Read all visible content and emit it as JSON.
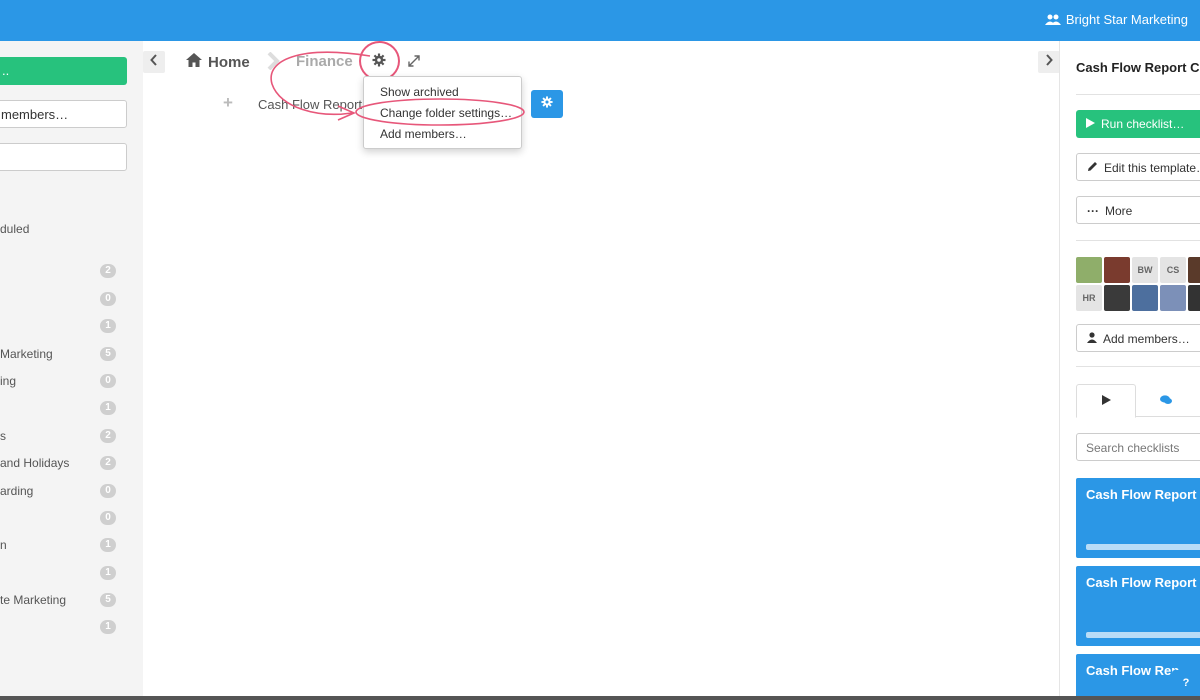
{
  "topbar": {
    "org_name": "Bright Star Marketing",
    "accent": "#2b97e6"
  },
  "left_sidebar": {
    "green_button_label": "..",
    "members_button_label": "members…",
    "items": [
      {
        "label": "duled"
      },
      {
        "label": "",
        "count": "2"
      },
      {
        "label": "",
        "count": "0"
      },
      {
        "label": "",
        "count": "1"
      },
      {
        "label": "Marketing",
        "count": "5"
      },
      {
        "label": "ing",
        "count": "0"
      },
      {
        "label": "",
        "count": "1"
      },
      {
        "label": "s",
        "count": "2"
      },
      {
        "label": "and Holidays",
        "count": "2"
      },
      {
        "label": "arding",
        "count": "0"
      },
      {
        "label": "",
        "count": "0"
      },
      {
        "label": "n",
        "count": "1"
      },
      {
        "label": "",
        "count": "1"
      },
      {
        "label": "te Marketing",
        "count": "5"
      },
      {
        "label": "",
        "count": "1"
      }
    ]
  },
  "breadcrumb": {
    "home": "Home",
    "finance": "Finance"
  },
  "folder": {
    "item_label": "Cash Flow Report"
  },
  "dropdown": {
    "items": [
      "Show archived",
      "Change folder settings…",
      "Add members…"
    ]
  },
  "right_panel": {
    "title": "Cash Flow Report Cr",
    "run_label": "Run checklist…",
    "edit_label": "Edit this template…",
    "more_label": "More",
    "avatars": [
      "",
      "",
      "BW",
      "CS",
      "",
      "HR",
      "",
      "",
      "",
      ""
    ],
    "add_members_label": "Add members…",
    "search_placeholder": "Search checklists",
    "cards": [
      "Cash Flow Report C",
      "Cash Flow Report C",
      "Cash Flow Rep"
    ],
    "green": "#27c27d"
  },
  "help_label": "?"
}
